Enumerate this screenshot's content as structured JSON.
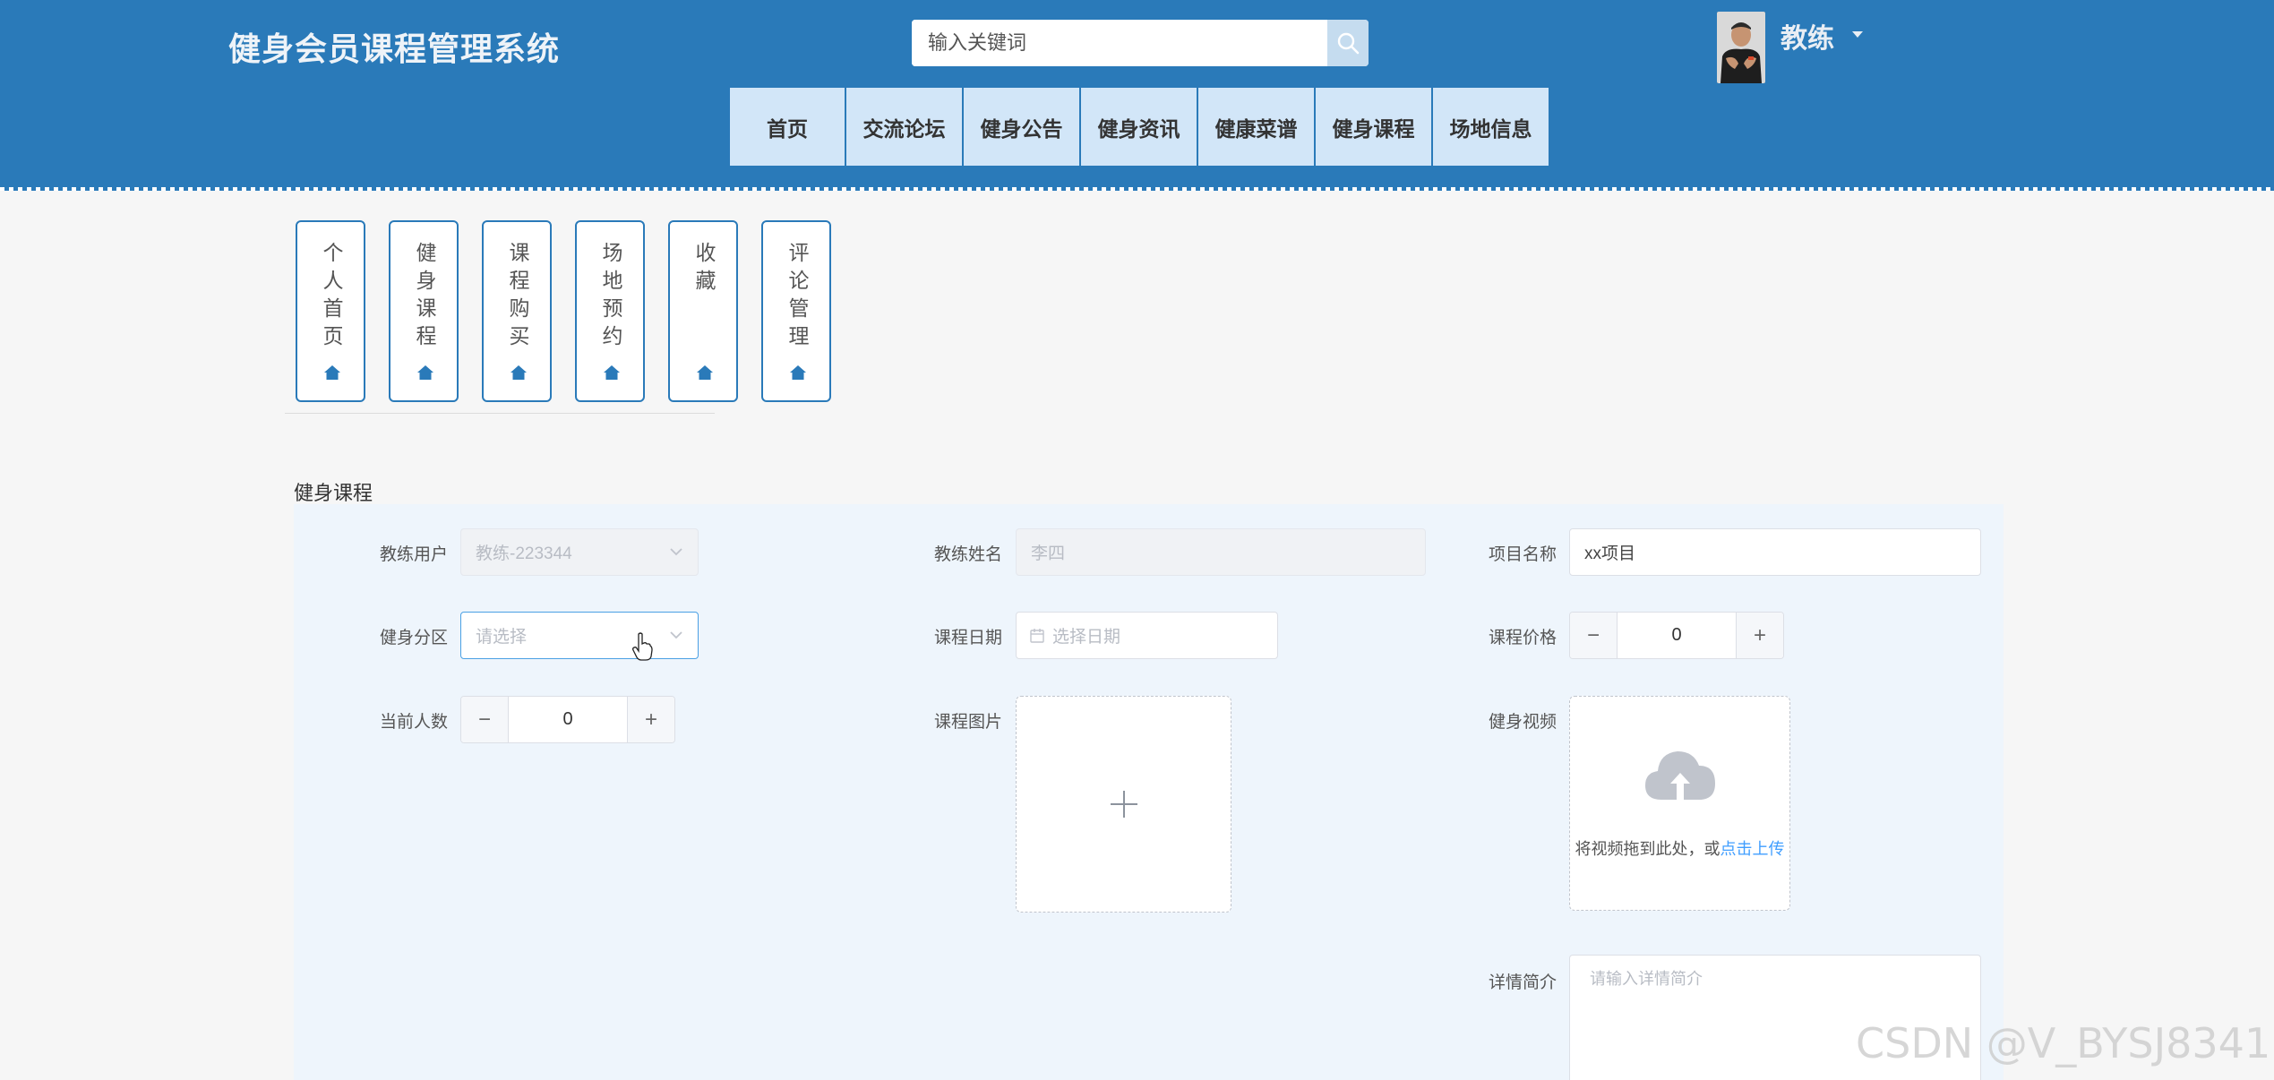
{
  "header": {
    "site_title": "健身会员课程管理系统",
    "search_placeholder": "输入关键词",
    "user_name": "教练"
  },
  "nav": [
    {
      "label": "首页"
    },
    {
      "label": "交流论坛"
    },
    {
      "label": "健身公告"
    },
    {
      "label": "健身资讯"
    },
    {
      "label": "健康菜谱"
    },
    {
      "label": "健身课程"
    },
    {
      "label": "场地信息"
    }
  ],
  "side_menu": [
    {
      "label": "个人首页"
    },
    {
      "label": "健身课程"
    },
    {
      "label": "课程购买"
    },
    {
      "label": "场地预约"
    },
    {
      "label": "收藏"
    },
    {
      "label": "评论管理"
    }
  ],
  "section": {
    "title": "健身课程"
  },
  "form": {
    "coach_user": {
      "label": "教练用户",
      "value": "教练-223344"
    },
    "coach_name": {
      "label": "教练姓名",
      "value": "李四"
    },
    "project_name": {
      "label": "项目名称",
      "value": "xx项目"
    },
    "zone": {
      "label": "健身分区",
      "placeholder": "请选择"
    },
    "course_date": {
      "label": "课程日期",
      "placeholder": "选择日期"
    },
    "course_price": {
      "label": "课程价格",
      "value": "0"
    },
    "current_count": {
      "label": "当前人数",
      "value": "0"
    },
    "course_image": {
      "label": "课程图片"
    },
    "fitness_video": {
      "label": "健身视频",
      "hint": "将视频拖到此处，或",
      "link": "点击上传"
    },
    "intro": {
      "label": "详情简介",
      "placeholder": "请输入详情简介"
    }
  },
  "watermark": "CSDN @V_BYSJ8341",
  "colors": {
    "primary": "#2a7ab9",
    "nav_bg": "#d2e6f8",
    "panel_bg": "#eef5fc",
    "link": "#409eff"
  }
}
